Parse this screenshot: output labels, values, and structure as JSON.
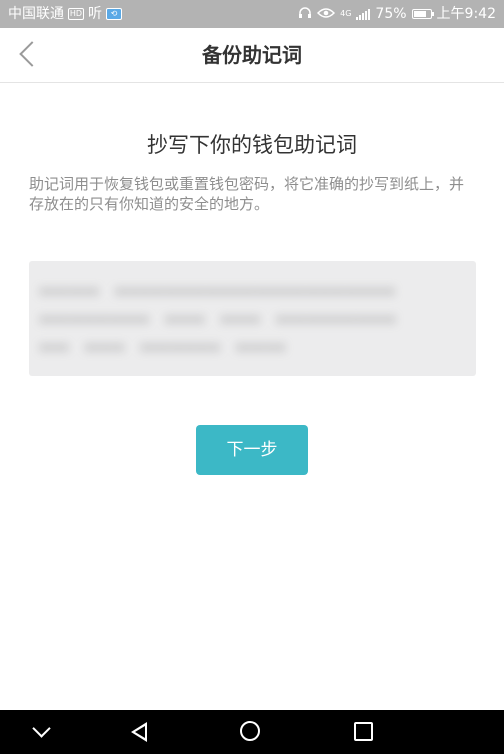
{
  "status_bar": {
    "carrier": "中国联通",
    "hd_badge": "HD",
    "listen_label": "听",
    "app_badge": "⟲",
    "network": "4G",
    "battery": "75%",
    "battery_level": 0.75,
    "time": "上午9:42"
  },
  "header": {
    "title": "备份助记词"
  },
  "main": {
    "heading": "抄写下你的钱包助记词",
    "description": "助记词用于恢复钱包或重置钱包密码，将它准确的抄写到纸上，并存放在的只有你知道的安全的地方。",
    "mnemonic_obscured": "•••••• •••••••••••••••••••••••••••• ••••••••••• •••• •••• •••••••••••• ••• •••• •••••••• •••••"
  },
  "actions": {
    "next_label": "下一步"
  },
  "system_nav": {
    "icons": [
      "chevron-down-icon",
      "back-triangle-icon",
      "home-circle-icon",
      "recent-apps-icon"
    ]
  },
  "colors": {
    "status_bar": "#b3b3b3",
    "accent": "#3cb8c6",
    "mnemonic_bg": "#ececed",
    "title_text": "#333333",
    "body_text": "#8e8e8e"
  }
}
